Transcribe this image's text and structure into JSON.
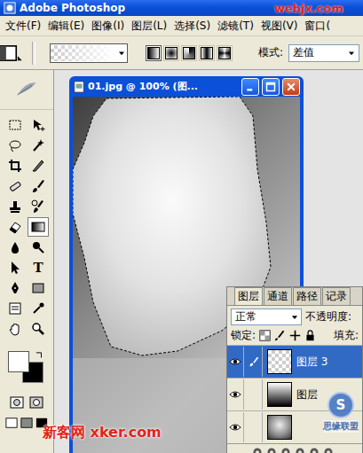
{
  "window": {
    "title": "Adobe Photoshop",
    "watermark": "webjx.com"
  },
  "menu": [
    "文件(F)",
    "编辑(E)",
    "图像(I)",
    "图层(L)",
    "选择(S)",
    "滤镜(T)",
    "视图(V)",
    "窗口("
  ],
  "options": {
    "gradient_types": [
      {
        "selected": true
      },
      {
        "selected": false
      },
      {
        "selected": false
      },
      {
        "selected": false
      },
      {
        "selected": false
      }
    ],
    "mode_label": "模式:",
    "mode_value": "差值"
  },
  "toolbox": {
    "tools": [
      {
        "selected": false
      },
      {
        "selected": false
      },
      {
        "selected": false
      },
      {
        "selected": false
      },
      {
        "selected": false
      },
      {
        "selected": false
      },
      {
        "selected": false
      },
      {
        "selected": false
      },
      {
        "selected": false
      },
      {
        "selected": false
      },
      {
        "selected": false
      },
      {
        "selected": true
      },
      {
        "selected": false
      },
      {
        "selected": false
      },
      {
        "selected": false
      },
      {
        "glyph": "T",
        "selected": false
      },
      {
        "selected": false
      },
      {
        "selected": false
      },
      {
        "selected": false
      },
      {
        "selected": false
      },
      {
        "selected": false
      },
      {
        "selected": false
      }
    ]
  },
  "document": {
    "title": "01.jpg @ 100% (图..."
  },
  "layers_panel": {
    "tabs": [
      {
        "label": "图层",
        "selected": true
      },
      {
        "label": "通道",
        "selected": false
      },
      {
        "label": "路径",
        "selected": false
      },
      {
        "label": "记录",
        "selected": false
      }
    ],
    "blend_mode": "正常",
    "opacity_label": "不透明度:",
    "lock_label": "锁定:",
    "fill_label": "填充:",
    "layers": [
      {
        "name": "图层 3",
        "selected": true,
        "visible": true,
        "paint_target": true,
        "kind": "transparent"
      },
      {
        "name": "图层",
        "selected": false,
        "visible": true,
        "paint_target": false,
        "kind": "gradient"
      },
      {
        "selected": false,
        "visible": true,
        "paint_target": false,
        "kind": "photo"
      }
    ]
  },
  "watermarks": {
    "site": "新客网 xker.com",
    "logo_glyph": "S",
    "logo_text": "思缘联盟"
  }
}
